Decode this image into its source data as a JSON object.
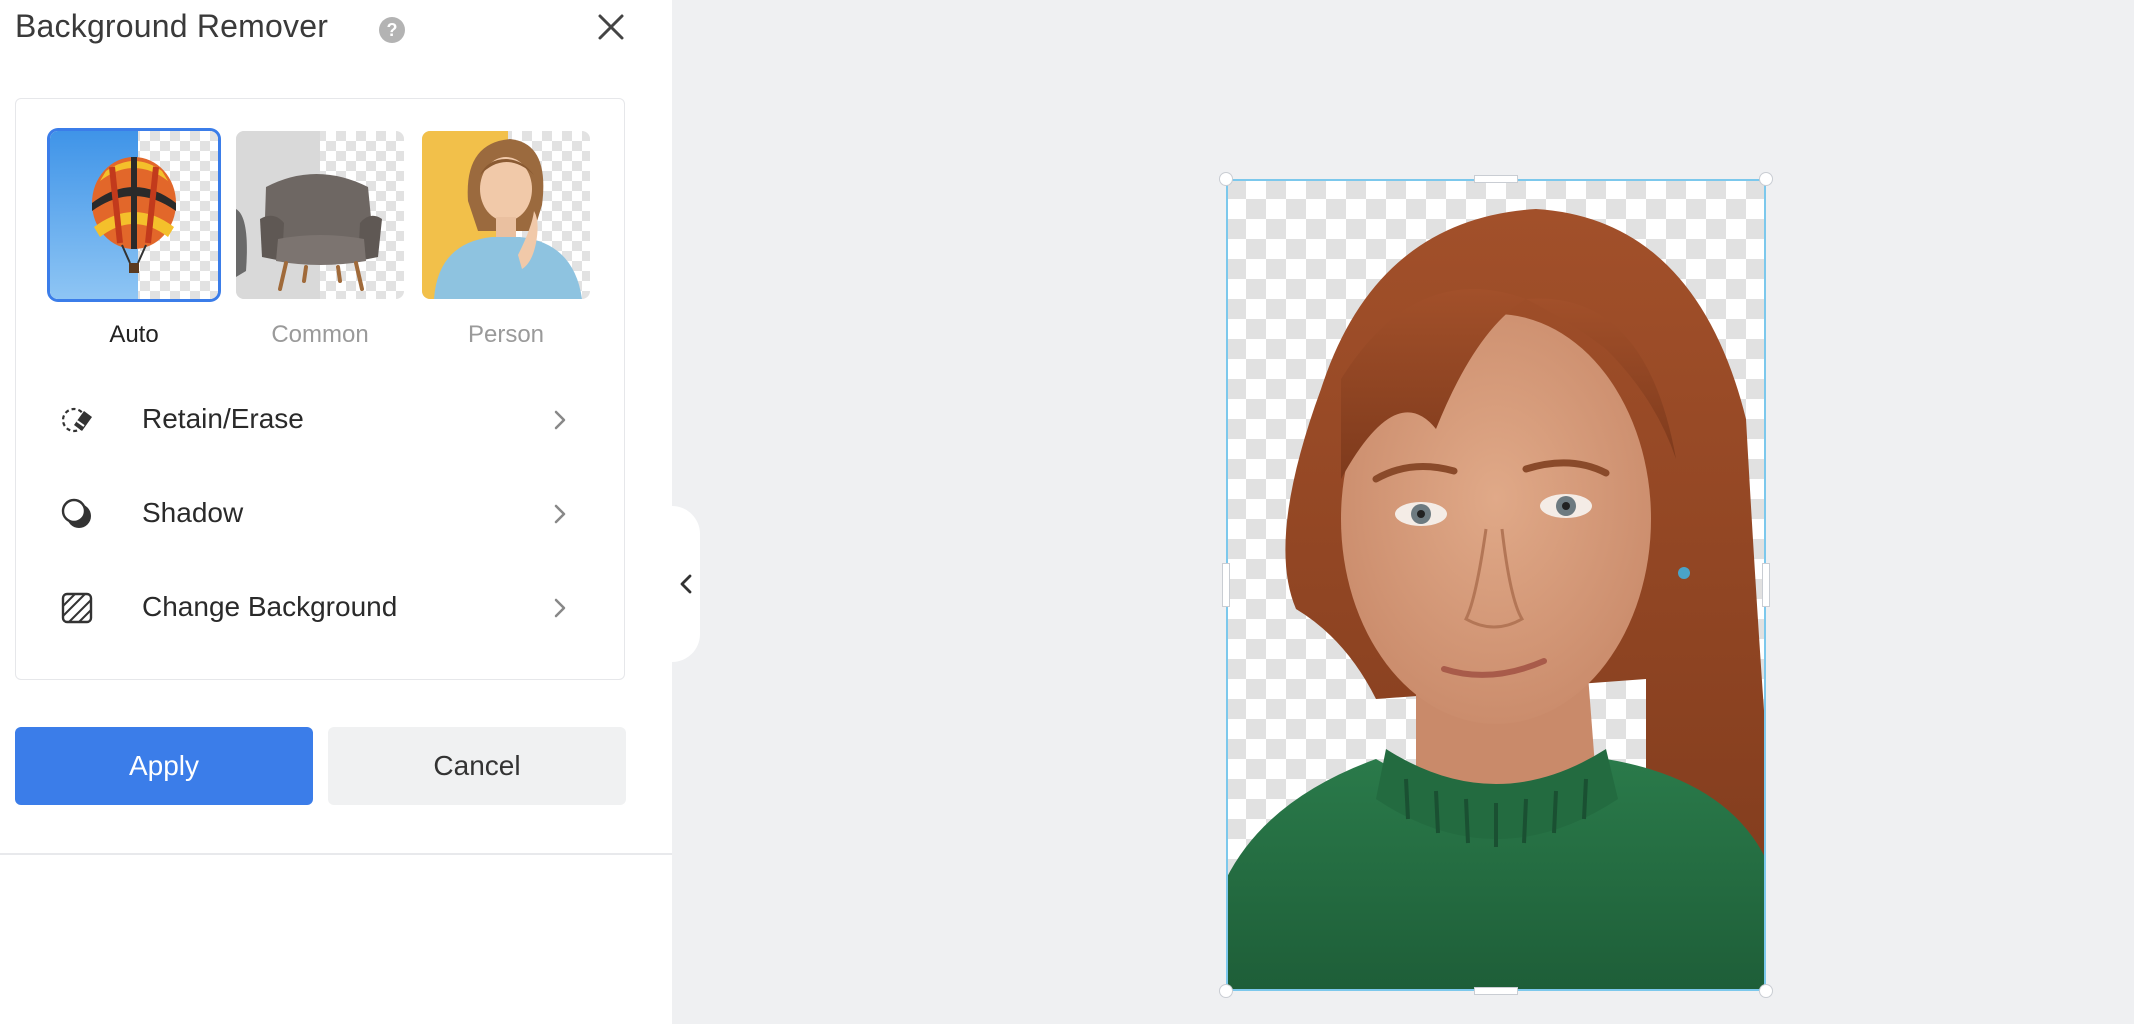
{
  "panel": {
    "title": "Background Remover",
    "help_icon": "question-circle-icon",
    "close_icon": "close-icon"
  },
  "modes": [
    {
      "label": "Auto",
      "selected": true
    },
    {
      "label": "Common",
      "selected": false
    },
    {
      "label": "Person",
      "selected": false
    }
  ],
  "options": [
    {
      "label": "Retain/Erase",
      "icon": "eraser-icon"
    },
    {
      "label": "Shadow",
      "icon": "shadow-icon"
    },
    {
      "label": "Change Background",
      "icon": "hatched-square-icon"
    }
  ],
  "actions": {
    "apply": "Apply",
    "cancel": "Cancel"
  },
  "colors": {
    "accent": "#3b7de9",
    "selection_border": "#7cc8ec",
    "canvas_bg": "#eff0f2"
  }
}
